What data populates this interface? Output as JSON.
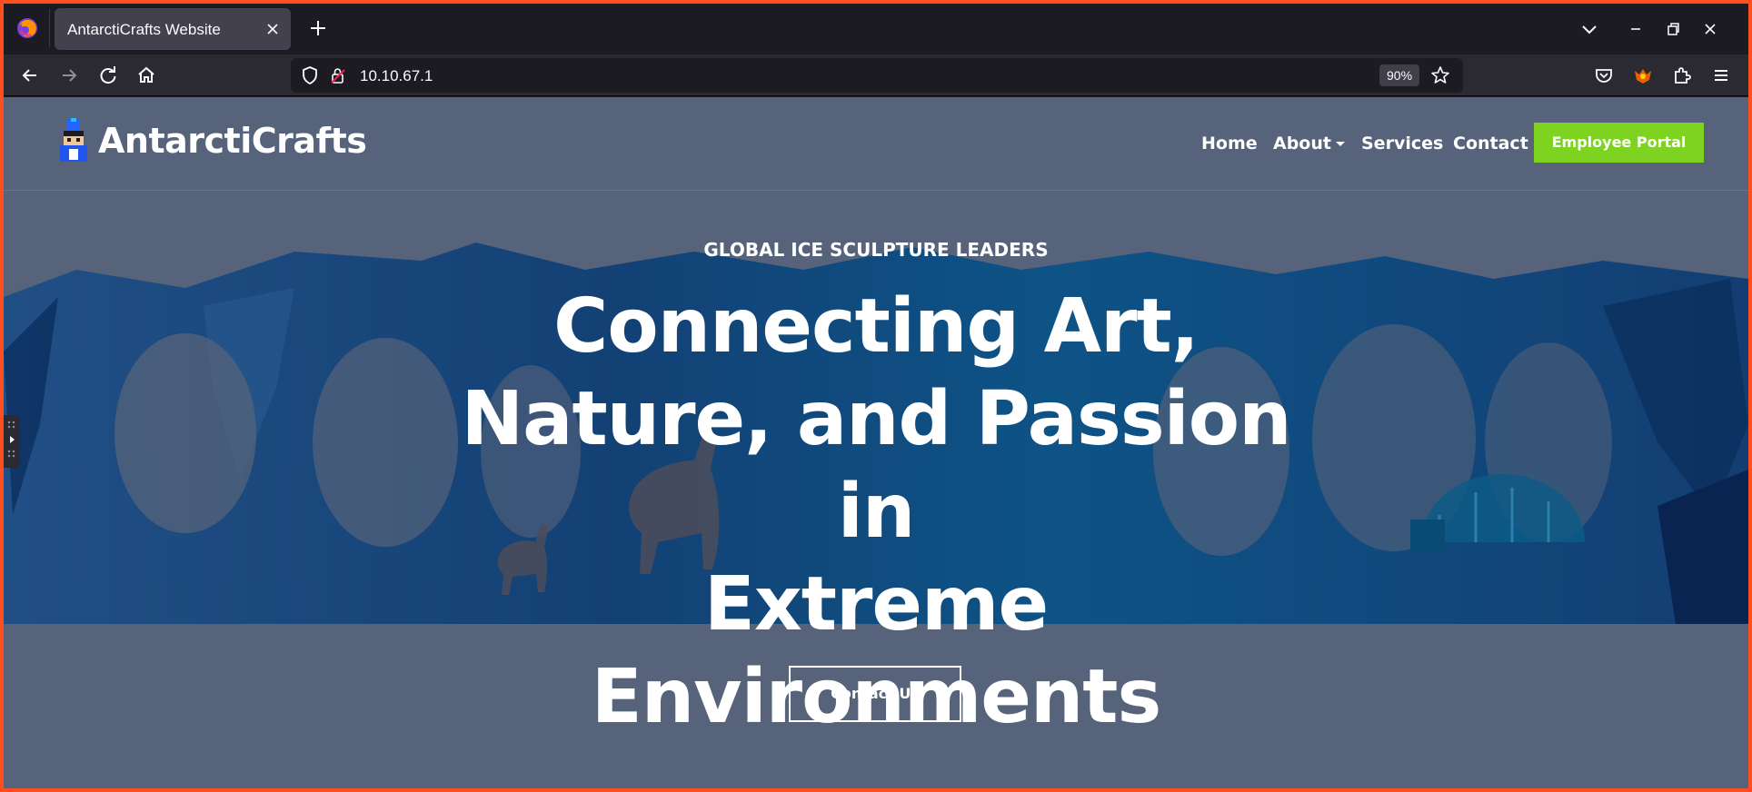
{
  "browser": {
    "tab_title": "AntarctiCrafts Website",
    "url": "10.10.67.1",
    "zoom": "90%"
  },
  "site": {
    "brand": "AntarctiCrafts",
    "nav": {
      "home": "Home",
      "about": "About",
      "services": "Services",
      "contact": "Contact",
      "portal": "Employee Portal"
    },
    "hero": {
      "eyebrow": "GLOBAL ICE SCULPTURE LEADERS",
      "headline_line1": "Connecting Art,",
      "headline_line2": "Nature, and Passion in",
      "headline_line3": "Extreme",
      "headline_line4": "Environments",
      "cta": "Contact Us"
    }
  },
  "colors": {
    "page_bg": "#56637a",
    "portal_green": "#7ed321",
    "hero_blue": "#0d3f73",
    "chrome_dark": "#1c1b22"
  }
}
